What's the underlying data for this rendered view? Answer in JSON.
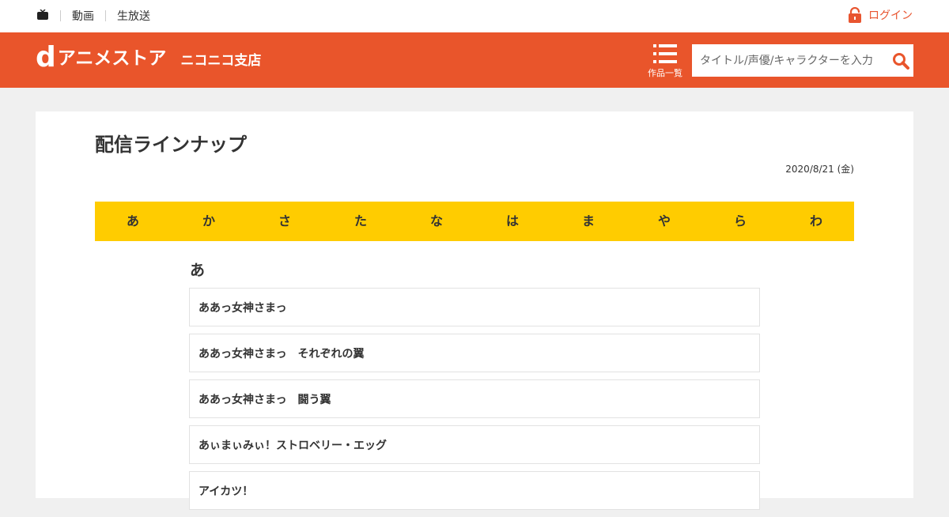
{
  "topbar": {
    "links": [
      "動画",
      "生放送"
    ],
    "login_label": "ログイン"
  },
  "header": {
    "logo_d": "d",
    "logo_brand": "アニメストア",
    "logo_branch": "ニコニコ支店",
    "menu_label": "作品一覧",
    "search_placeholder": "タイトル/声優/キャラクターを入力"
  },
  "main": {
    "title": "配信ラインナップ",
    "date": "2020/8/21 (金)",
    "kana_tabs": [
      "あ",
      "か",
      "さ",
      "た",
      "な",
      "は",
      "ま",
      "や",
      "ら",
      "わ"
    ],
    "section_title": "あ",
    "items": [
      "ああっ女神さまっ",
      "ああっ女神さまっ　それぞれの翼",
      "ああっ女神さまっ　闘う翼",
      "あぃまぃみぃ！ストロベリー・エッグ",
      "アイカツ！"
    ]
  },
  "colors": {
    "brand": "#e9552b",
    "kana_bar": "#ffcc00",
    "background": "#f0f0f0"
  },
  "icons": {
    "tv": "tv-icon",
    "lock": "lock-icon",
    "menu": "list-menu-icon",
    "search": "search-icon"
  }
}
